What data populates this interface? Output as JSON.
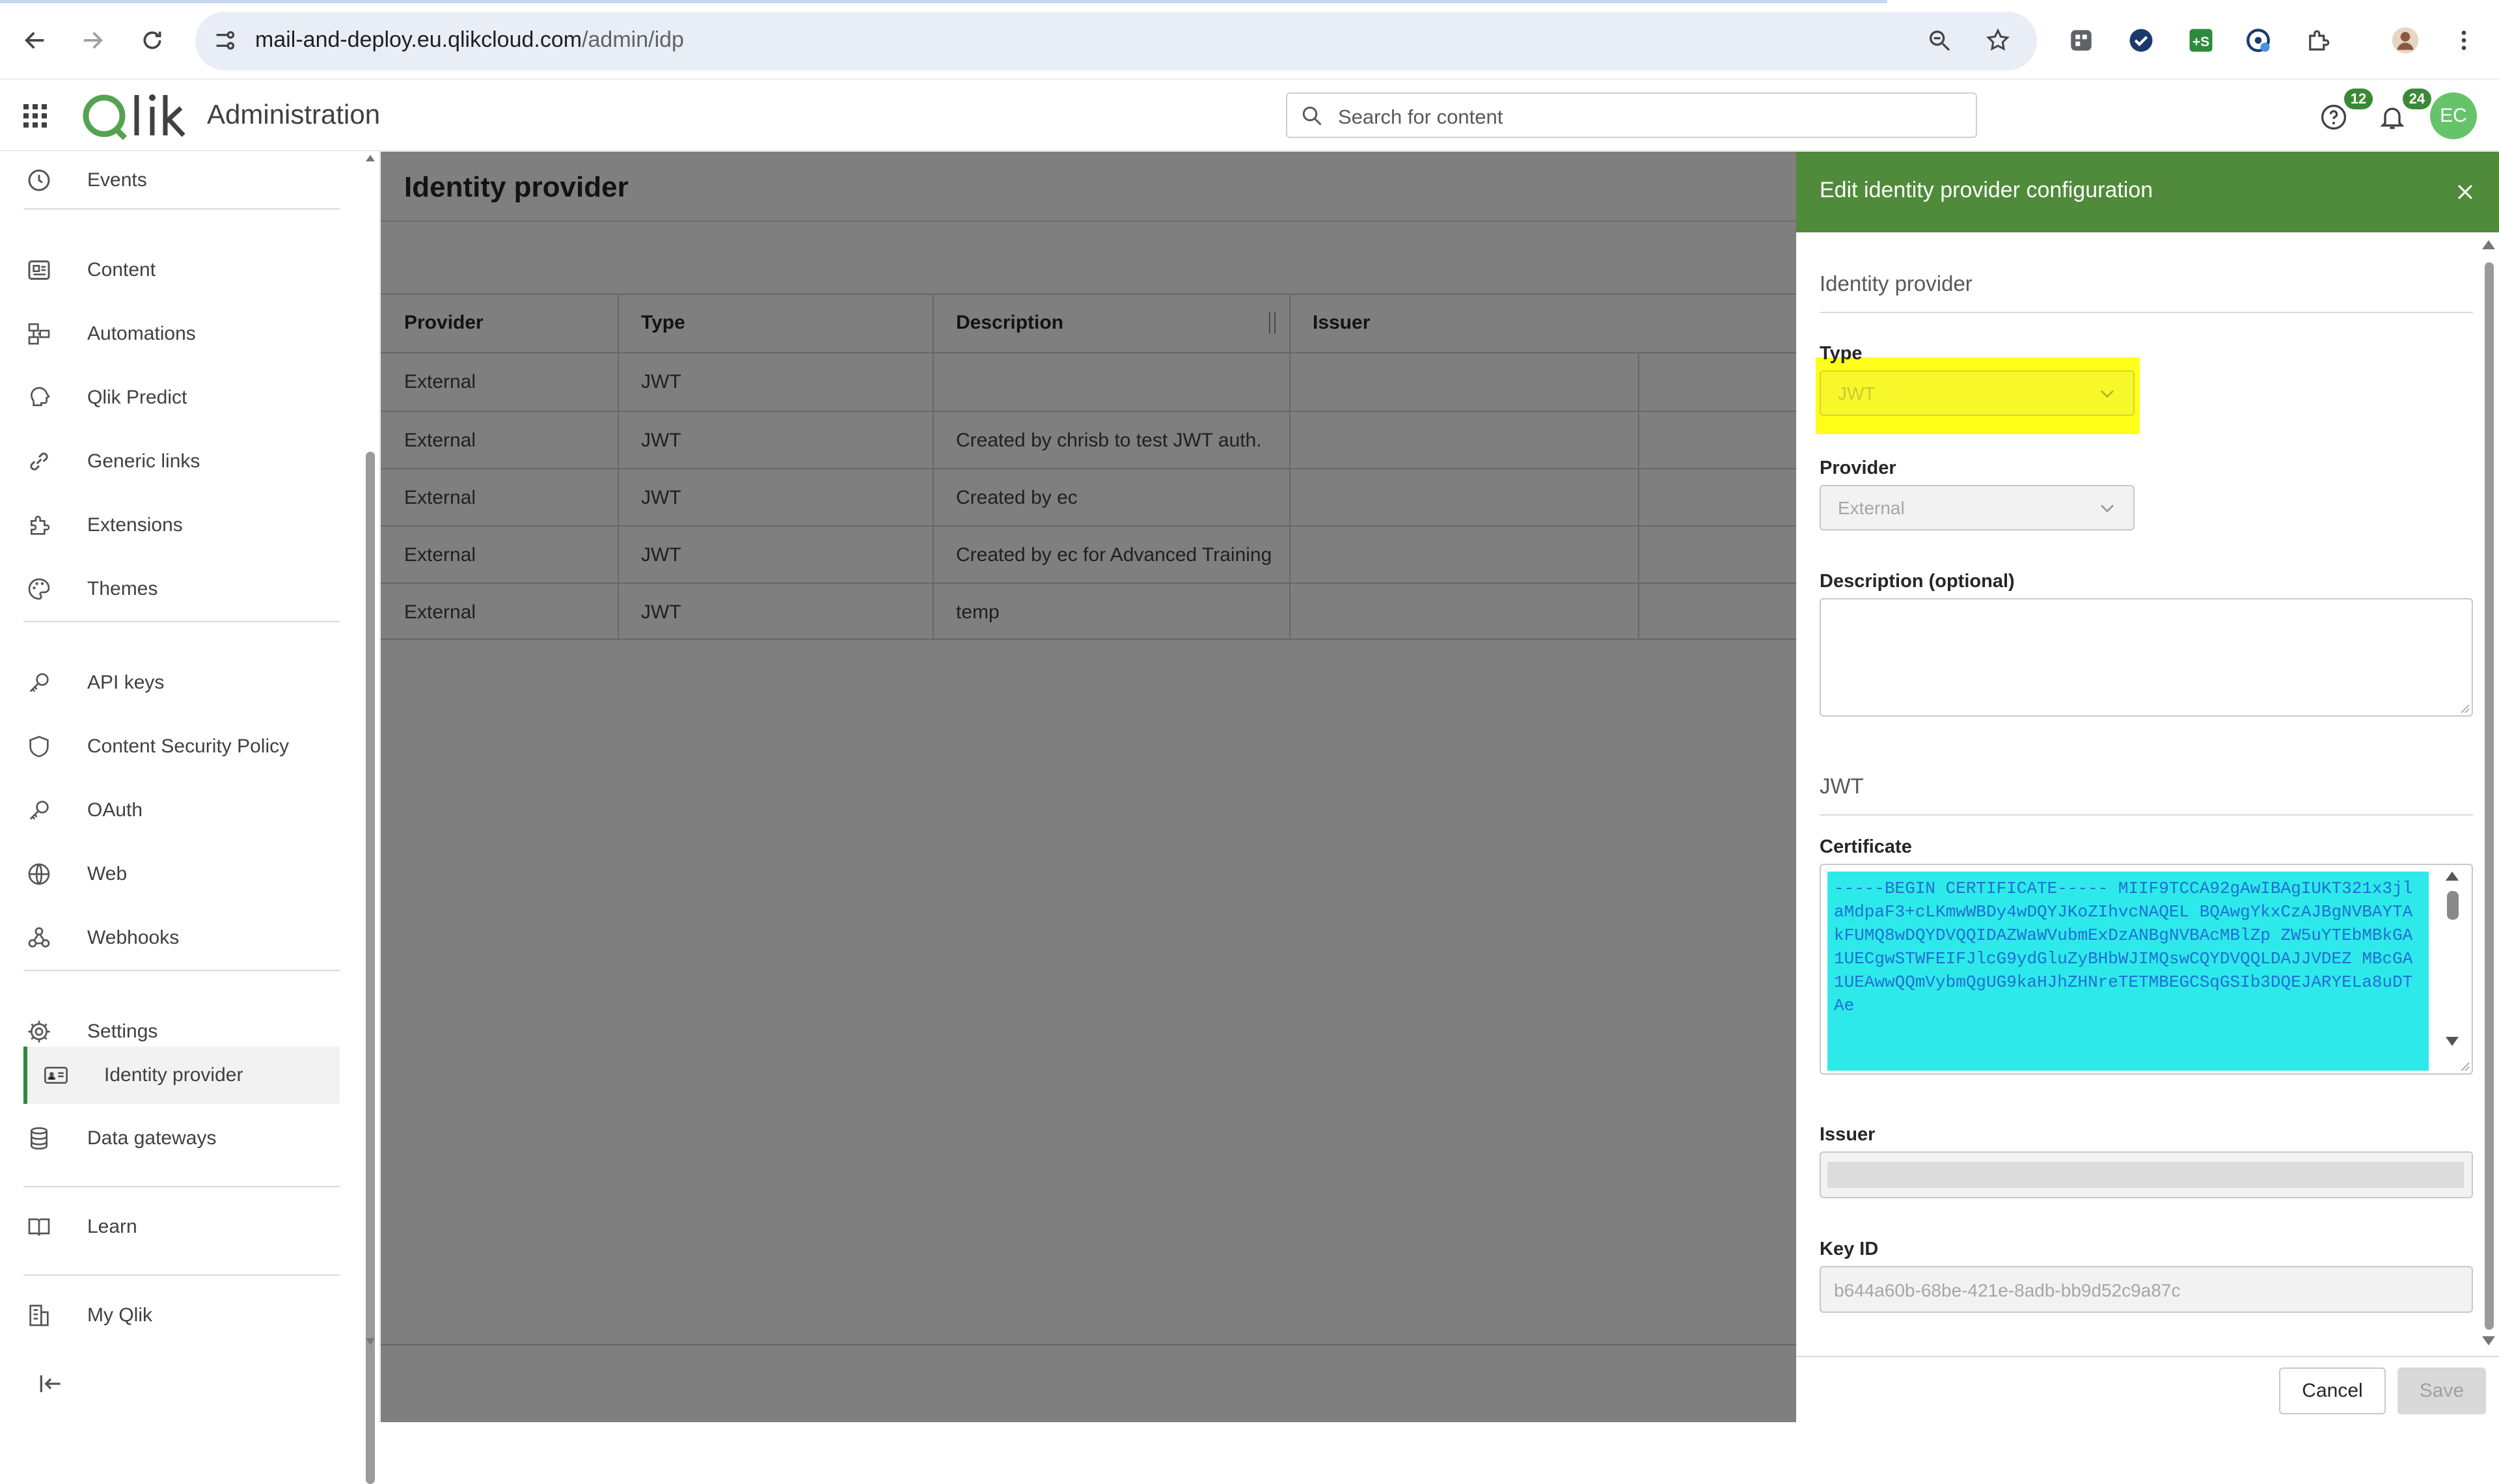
{
  "browser": {
    "url_host": "mail-and-deploy.eu.qlikcloud.com",
    "url_path": "/admin/idp"
  },
  "topbar": {
    "logo_text": "Qlik",
    "app_title": "Administration",
    "search_placeholder": "Search for content",
    "help_badge": "12",
    "notifications_badge": "24",
    "avatar_initials": "EC"
  },
  "sidebar": {
    "items": [
      {
        "label": "Events",
        "icon": "clock-icon"
      },
      {
        "label": "Content",
        "icon": "content-icon"
      },
      {
        "label": "Automations",
        "icon": "automation-icon"
      },
      {
        "label": "Qlik Predict",
        "icon": "predict-icon"
      },
      {
        "label": "Generic links",
        "icon": "link-icon"
      },
      {
        "label": "Extensions",
        "icon": "puzzle-icon"
      },
      {
        "label": "Themes",
        "icon": "palette-icon"
      },
      {
        "label": "API keys",
        "icon": "key-icon"
      },
      {
        "label": "Content Security Policy",
        "icon": "shield-icon"
      },
      {
        "label": "OAuth",
        "icon": "key-icon"
      },
      {
        "label": "Web",
        "icon": "globe-icon"
      },
      {
        "label": "Webhooks",
        "icon": "webhook-icon"
      },
      {
        "label": "Settings",
        "icon": "gear-icon"
      },
      {
        "label": "Identity provider",
        "icon": "id-card-icon"
      },
      {
        "label": "Data gateways",
        "icon": "database-icon"
      },
      {
        "label": "Learn",
        "icon": "book-icon"
      },
      {
        "label": "My Qlik",
        "icon": "building-icon"
      }
    ],
    "active": "Identity provider",
    "collapse_icon": "collapse-icon"
  },
  "main": {
    "page_title": "Identity provider",
    "columns": [
      "Provider",
      "Type",
      "Description",
      "Issuer"
    ],
    "rows": [
      [
        "External",
        "JWT",
        "",
        ""
      ],
      [
        "External",
        "JWT",
        "Created by chrisb to test JWT auth.",
        ""
      ],
      [
        "External",
        "JWT",
        "Created by ec",
        ""
      ],
      [
        "External",
        "JWT",
        "Created by ec for Advanced Training",
        ""
      ],
      [
        "External",
        "JWT",
        "temp",
        ""
      ]
    ]
  },
  "panel": {
    "title": "Edit identity provider configuration",
    "section_idp": "Identity provider",
    "type_label": "Type",
    "type_value": "JWT",
    "provider_label": "Provider",
    "provider_value": "External",
    "description_label": "Description (optional)",
    "description_value": "",
    "section_jwt": "JWT",
    "certificate_label": "Certificate",
    "certificate_value": "-----BEGIN CERTIFICATE----- MIIF9TCCA92gAwIBAgIUKT321x3jlaMdpaF3+cLKmwWBDy4wDQYJKoZIhvcNAQEL BQAwgYkxCzAJBgNVBAYTAkFUMQ8wDQYDVQQIDAZWaWVubmExDzANBgNVBAcMBlZp ZW5uYTEbMBkGA1UECgwSTWFEIFJlcG9ydGluZyBHbWJIMQswCQYDVQQLDAJJVDEZ MBcGA1UEAwwQQmVybmQgUG9kaHJhZHNreTETMBEGCSqGSIb3DQEJARYELa8uDTAe",
    "issuer_label": "Issuer",
    "issuer_value": "",
    "keyid_label": "Key ID",
    "keyid_value": "b644a60b-68be-421e-8adb-bb9d52c9a87c",
    "cancel_label": "Cancel",
    "save_label": "Save",
    "highlight_color": "#ffff1a",
    "header_color": "#4f8b3a"
  }
}
